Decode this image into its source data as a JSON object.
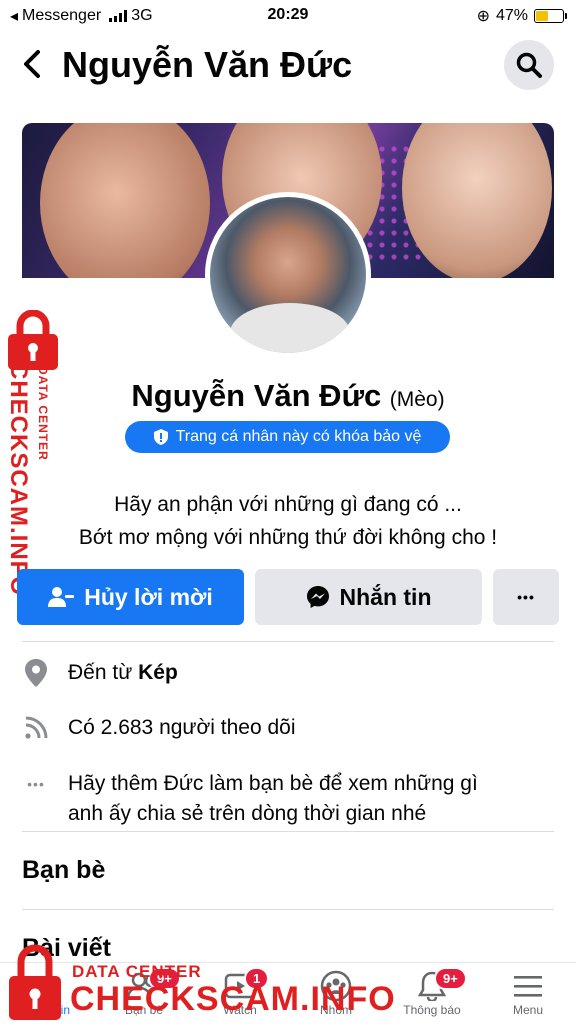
{
  "status_bar": {
    "carrier_app": "Messenger",
    "network": "3G",
    "time": "20:29",
    "battery": "47%",
    "battery_level": 0.47
  },
  "header": {
    "title": "Nguyễn Văn Đức"
  },
  "profile": {
    "name": "Nguyễn Văn Đức",
    "nickname": "(Mèo)",
    "guard_badge": "Trang cá nhân này có khóa bảo vệ",
    "bio_line1": "Hãy an phận với những gì đang có ...",
    "bio_line2": "Bớt mơ mộng với những thứ đời không cho !"
  },
  "actions": {
    "primary": "Hủy lời mời",
    "message": "Nhắn tin",
    "more": "•••"
  },
  "info": {
    "from_prefix": "Đến từ ",
    "from_place": "Kép",
    "followers": "Có 2.683 người theo dõi",
    "add_friend_line1": "Hãy thêm Đức làm bạn bè để xem những gì",
    "add_friend_line2": "anh ấy chia sẻ trên dòng thời gian nhé"
  },
  "sections": {
    "friends": "Bạn bè",
    "posts": "Bài viết"
  },
  "bottom_nav": {
    "items": [
      {
        "label": "Bảng tin",
        "icon": "home-icon"
      },
      {
        "label": "Bạn bè",
        "icon": "friends-icon",
        "badge": "9+"
      },
      {
        "label": "Watch",
        "icon": "watch-icon",
        "badge": "1"
      },
      {
        "label": "Nhóm",
        "icon": "groups-icon"
      },
      {
        "label": "Thông báo",
        "icon": "bell-icon",
        "badge": "9+"
      },
      {
        "label": "Menu",
        "icon": "menu-icon"
      }
    ]
  },
  "watermark": {
    "vertical_big": "CHECKSCAM.INFO",
    "vertical_small": "DATA CENTER",
    "bottom_small": "DATA CENTER",
    "bottom_big": "CHECKSCAM.INFO"
  },
  "colors": {
    "accent": "#1877f2",
    "secondary_bg": "#e4e6eb",
    "badge_red": "#e41e3f",
    "watermark_red": "#e02020"
  }
}
